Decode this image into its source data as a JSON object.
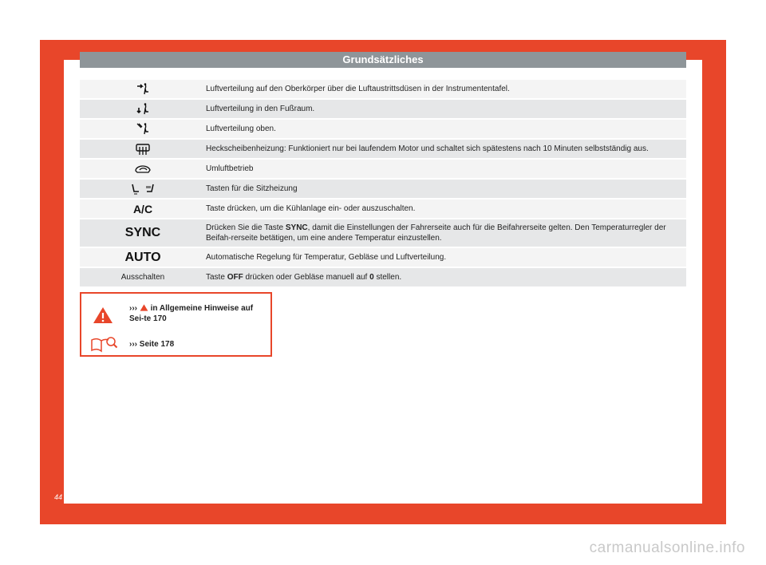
{
  "header": {
    "title": "Grundsätzliches"
  },
  "rows": [
    {
      "icon": "air-upper-body-icon",
      "text": "Luftverteilung auf den Oberkörper über die Luftaustrittsdüsen in der Instrumententafel."
    },
    {
      "icon": "air-footwell-icon",
      "text": "Luftverteilung in den Fußraum."
    },
    {
      "icon": "air-windshield-icon",
      "text": "Luftverteilung oben."
    },
    {
      "icon": "rear-defrost-icon",
      "text": "Heckscheibenheizung: Funktioniert nur bei laufendem Motor und schaltet sich spätestens nach 10 Minuten selbstständig aus."
    },
    {
      "icon": "recirculation-icon",
      "text": "Umluftbetrieb"
    },
    {
      "icon": "seat-heating-icon",
      "text": "Tasten für die Sitzheizung"
    },
    {
      "label": "A/C",
      "text": "Taste drücken, um die Kühlanlage ein- oder auszuschalten."
    },
    {
      "label": "SYNC",
      "text_pre": "Drücken Sie die Taste",
      "inline": "SYNC",
      "text_post": ", damit die Einstellungen der Fahrerseite auch für die Beifahrerseite gelten. Den Temperaturregler der Beifah-rerseite betätigen, um eine andere Temperatur einzustellen."
    },
    {
      "label": "AUTO",
      "text": "Automatische Regelung für Temperatur, Gebläse und Luftverteilung."
    },
    {
      "label": "Ausschalten",
      "text_pre": "Taste",
      "inline": "OFF",
      "text_mid": "drücken oder Gebläse manuell auf",
      "inline2": "0",
      "text_post": "stellen."
    }
  ],
  "warning": {
    "ref1_arrows": "›››",
    "ref1_text": "in Allgemeine Hinweise auf Sei-te 170",
    "ref2_arrows": "›››",
    "ref2_text": "Seite 178"
  },
  "page_number": "44",
  "watermark": "carmanualsonline.info",
  "colors": {
    "frame": "#e8462a",
    "header": "#8e9599",
    "row": "#f4f4f4",
    "row_alt": "#e6e7e8"
  }
}
